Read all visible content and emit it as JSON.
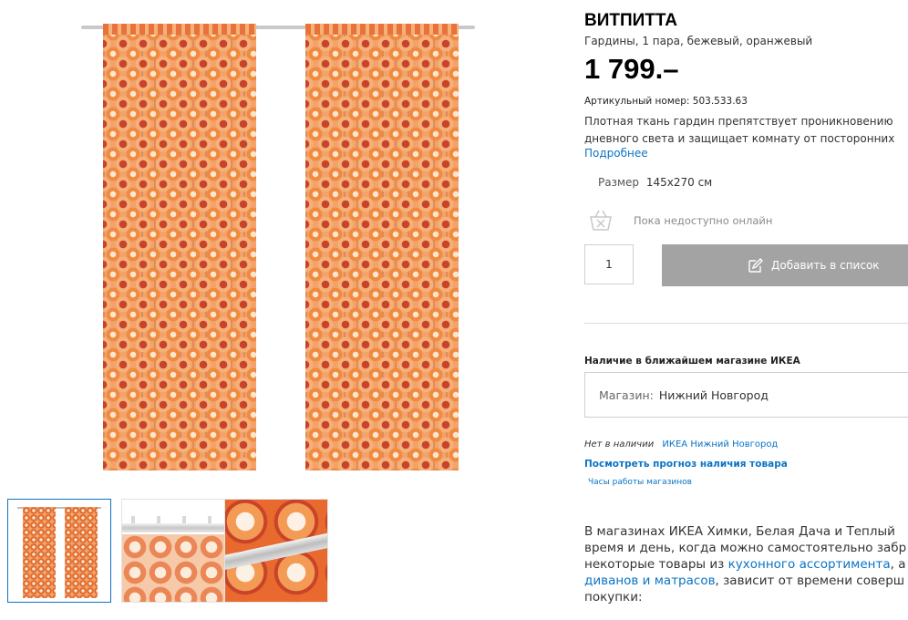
{
  "product": {
    "name": "ВИТПИТТА",
    "description": "Гардины, 1 пара, бежевый, оранжевый",
    "price": "1 799.–",
    "article_label": "Артикульный номер:",
    "article_number": "503.533.63",
    "details_lines": [
      "Плотная ткань гардин препятствует проникновению",
      "дневного света и защищает комнату от посторонних"
    ],
    "more_link": "Подробнее",
    "size_label": "Размер",
    "size_value": "145x270 см",
    "availability_online": "Пока недоступно онлайн"
  },
  "purchase": {
    "quantity": "1",
    "add_to_list_label": "Добавить в список"
  },
  "store": {
    "section_title": "Наличие в ближайшем магазине ИКЕА",
    "select_label": "Магазин:",
    "select_value": "Нижний Новгород",
    "stock_status": "Нет в наличии",
    "stock_store": "ИКЕА Нижний Новгород",
    "forecast_link": "Посмотреть прогноз наличия товара",
    "hours_link": "Часы работы магазинов"
  },
  "pickup": {
    "line1": "В магазинах ИКЕА Химки, Белая Дача и Теплый",
    "line2": "время и день, когда можно самостоятельно забр",
    "line3_prefix": "некоторые товары из ",
    "line3_link": "кухонного ассортимента",
    "line3_suffix": ", а",
    "line4_link": "диванов и матрасов",
    "line4_suffix": ", зависит от времени соверш",
    "line5": "покупки:"
  },
  "gallery": {
    "active_thumbnail": 1,
    "thumbnails": [
      "curtains-full-view",
      "curtain-top-hooks",
      "curtain-fabric-detail"
    ]
  },
  "colors": {
    "link": "#0a74c6",
    "button_disabled": "#a3a3a3",
    "active_thumb_border": "#0a74c6",
    "curtain_orange": "#f3a26b"
  },
  "icons": [
    "basket-unavailable-icon",
    "edit-list-icon"
  ]
}
